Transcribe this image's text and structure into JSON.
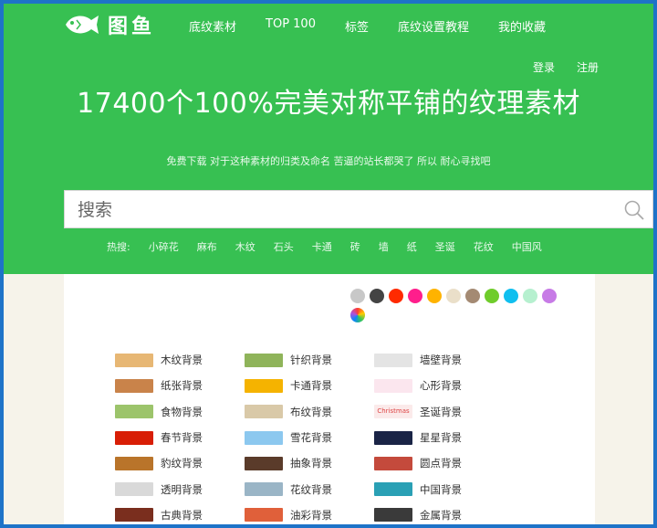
{
  "brand": {
    "name": "图鱼"
  },
  "nav": [
    {
      "label": "底纹素材"
    },
    {
      "label": "TOP 100"
    },
    {
      "label": "标签"
    },
    {
      "label": "底纹设置教程"
    },
    {
      "label": "我的收藏"
    }
  ],
  "auth": {
    "login": "登录",
    "register": "注册"
  },
  "headline": "17400个100%完美对称平铺的纹理素材",
  "subtitle": "免费下载 对于这种素材的归类及命名 苦逼的站长都哭了 所以 耐心寻找吧",
  "search": {
    "placeholder": "搜索"
  },
  "hot": {
    "label": "热搜:",
    "tags": [
      "小碎花",
      "麻布",
      "木纹",
      "石头",
      "卡通",
      "砖",
      "墙",
      "纸",
      "圣诞",
      "花纹",
      "中国风"
    ]
  },
  "color_filters": [
    "#c8c8c8",
    "#444444",
    "#ff2a00",
    "#ff1e8c",
    "#ffb300",
    "#eadfc9",
    "#a48a73",
    "#6fcc2b",
    "#10bfef",
    "#b6f0cf",
    "#c77be6",
    "rainbow"
  ],
  "categories": [
    [
      {
        "label": "木纹背景",
        "icon": "wood-texture-thumbnail",
        "color": "#e7b774"
      },
      {
        "label": "针织背景",
        "icon": "knit-texture-thumbnail",
        "color": "#8fb45a"
      },
      {
        "label": "墙壁背景",
        "icon": "wall-texture-thumbnail",
        "color": "#e4e4e4"
      }
    ],
    [
      {
        "label": "纸张背景",
        "icon": "paper-texture-thumbnail",
        "color": "#c9834a"
      },
      {
        "label": "卡通背景",
        "icon": "cartoon-texture-thumbnail",
        "color": "#f5b300"
      },
      {
        "label": "心形背景",
        "icon": "heart-texture-thumbnail",
        "color": "#fbe6ee"
      }
    ],
    [
      {
        "label": "食物背景",
        "icon": "food-texture-thumbnail",
        "color": "#9cc46b"
      },
      {
        "label": "布纹背景",
        "icon": "fabric-texture-thumbnail",
        "color": "#d9c9a8"
      },
      {
        "label": "圣诞背景",
        "icon": "christmas-texture-thumbnail",
        "color": "#fbeaea",
        "text": "Christmas"
      }
    ],
    [
      {
        "label": "春节背景",
        "icon": "spring-festival-texture-thumbnail",
        "color": "#d81e06"
      },
      {
        "label": "雪花背景",
        "icon": "snowflake-texture-thumbnail",
        "color": "#8cc8ef"
      },
      {
        "label": "星星背景",
        "icon": "stars-texture-thumbnail",
        "color": "#1a2446"
      }
    ],
    [
      {
        "label": "豹纹背景",
        "icon": "leopard-texture-thumbnail",
        "color": "#b9742a"
      },
      {
        "label": "抽象背景",
        "icon": "abstract-texture-thumbnail",
        "color": "#5a3b2a"
      },
      {
        "label": "圆点背景",
        "icon": "polka-dot-texture-thumbnail",
        "color": "#c44a3c"
      }
    ],
    [
      {
        "label": "透明背景",
        "icon": "transparent-checker-thumbnail",
        "color": "#d9d9d9"
      },
      {
        "label": "花纹背景",
        "icon": "pattern-texture-thumbnail",
        "color": "#9ab5c6"
      },
      {
        "label": "中国背景",
        "icon": "chinese-texture-thumbnail",
        "color": "#2aa0b5"
      }
    ],
    [
      {
        "label": "古典背景",
        "icon": "classical-texture-thumbnail",
        "color": "#7a2e1e"
      },
      {
        "label": "油彩背景",
        "icon": "oil-paint-texture-thumbnail",
        "color": "#e0603a"
      },
      {
        "label": "金属背景",
        "icon": "metal-texture-thumbnail",
        "color": "#3a3a3a"
      }
    ]
  ]
}
